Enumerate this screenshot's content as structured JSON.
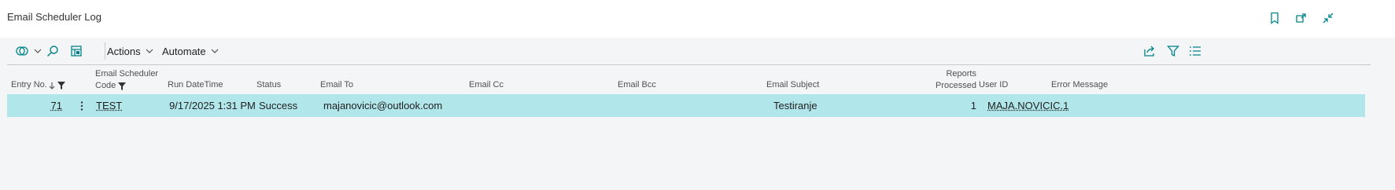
{
  "page": {
    "title": "Email Scheduler Log"
  },
  "title_actions": [
    {
      "icon": "bookmark-icon"
    },
    {
      "icon": "open-new-window-icon"
    },
    {
      "icon": "collapse-icon"
    }
  ],
  "toolbar": {
    "actions_label": "Actions",
    "automate_label": "Automate",
    "icons": [
      "copilot-icon",
      "search-icon",
      "edit-list-icon",
      "share-icon",
      "filter-icon",
      "list-view-icon"
    ]
  },
  "table": {
    "headers": {
      "entry_no": "Entry No.",
      "email_scheduler_code_line1": "Email Scheduler",
      "email_scheduler_code_line2": "Code",
      "run_datetime": "Run DateTime",
      "status": "Status",
      "email_to": "Email To",
      "email_cc": "Email Cc",
      "email_bcc": "Email Bcc",
      "email_subject": "Email Subject",
      "reports_processed_line1": "Reports",
      "reports_processed_line2": "Processed",
      "user_id": "User ID",
      "error_message": "Error Message"
    },
    "rows": [
      {
        "entry_no": "71",
        "email_scheduler_code": "TEST",
        "run_datetime": "9/17/2025 1:31 PM",
        "status": "Success",
        "email_to": "majanovicic@outlook.com",
        "email_cc": "",
        "email_bcc": "",
        "email_subject": "Testiranje",
        "reports_processed": "1",
        "user_id": "MAJA.NOVICIC.1",
        "error_message": ""
      }
    ]
  },
  "colors": {
    "selected_row": "#b1e6ea",
    "accent": "#008489",
    "background": "#f4f5f6"
  }
}
